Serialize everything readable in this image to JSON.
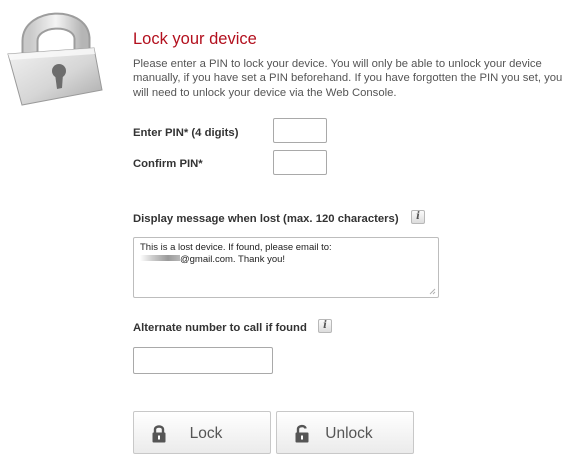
{
  "header": {
    "padlock_icon": "padlock-icon",
    "title": "Lock your device",
    "intro": "Please enter a PIN to lock your device. You will only be able to unlock your device manually, if you have set a PIN beforehand. If you have forgotten the PIN you set, you will need to unlock your device via the Web Console."
  },
  "pin": {
    "enter_label": "Enter PIN* (4 digits)",
    "enter_value": "",
    "confirm_label": "Confirm PIN*",
    "confirm_value": ""
  },
  "message": {
    "label": "Display message when lost (max. 120 characters)",
    "info_icon": "info-icon",
    "info_glyph": "i",
    "line1": "This is a lost device. If found, please email to:",
    "line2_suffix": "@gmail.com. Thank you!"
  },
  "alternate": {
    "label": "Alternate number to call if found",
    "info_glyph": "i",
    "value": ""
  },
  "buttons": {
    "lock_label": "Lock",
    "lock_icon": "closed-padlock-icon",
    "unlock_label": "Unlock",
    "unlock_icon": "open-padlock-icon"
  },
  "colors": {
    "title": "#b3101e",
    "text": "#555555",
    "border": "#a9a9a9"
  }
}
